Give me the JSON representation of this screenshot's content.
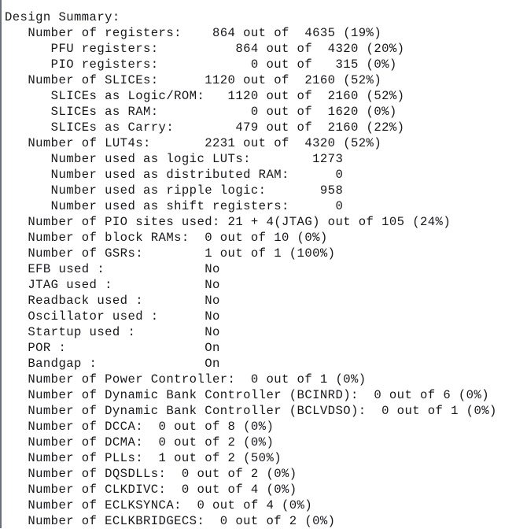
{
  "report": {
    "title": "Design Summary:",
    "text_color": "#15171c",
    "background_color": "#ffffff",
    "left_border_color": "#6b6f7c",
    "lines": [
      "Design Summary:",
      "   Number of registers:    864 out of  4635 (19%)",
      "      PFU registers:          864 out of  4320 (20%)",
      "      PIO registers:            0 out of   315 (0%)",
      "   Number of SLICEs:      1120 out of  2160 (52%)",
      "      SLICEs as Logic/ROM:   1120 out of  2160 (52%)",
      "      SLICEs as RAM:            0 out of  1620 (0%)",
      "      SLICEs as Carry:        479 out of  2160 (22%)",
      "   Number of LUT4s:       2231 out of  4320 (52%)",
      "      Number used as logic LUTs:        1273",
      "      Number used as distributed RAM:      0",
      "      Number used as ripple logic:       958",
      "      Number used as shift registers:      0",
      "   Number of PIO sites used: 21 + 4(JTAG) out of 105 (24%)",
      "   Number of block RAMs:  0 out of 10 (0%)",
      "   Number of GSRs:        1 out of 1 (100%)",
      "   EFB used :             No",
      "   JTAG used :            No",
      "   Readback used :        No",
      "   Oscillator used :      No",
      "   Startup used :         No",
      "   POR :                  On",
      "   Bandgap :              On",
      "   Number of Power Controller:  0 out of 1 (0%)",
      "   Number of Dynamic Bank Controller (BCINRD):  0 out of 6 (0%)",
      "   Number of Dynamic Bank Controller (BCLVDSO):  0 out of 1 (0%)",
      "   Number of DCCA:  0 out of 8 (0%)",
      "   Number of DCMA:  0 out of 2 (0%)",
      "   Number of PLLs:  1 out of 2 (50%)",
      "   Number of DQSDLLs:  0 out of 2 (0%)",
      "   Number of CLKDIVC:  0 out of 4 (0%)",
      "   Number of ECLKSYNCA:  0 out of 4 (0%)",
      "   Number of ECLKBRIDGECS:  0 out of 2 (0%)"
    ],
    "entries": [
      {
        "label": "Number of registers",
        "used": "864",
        "total": "4635",
        "percent": "19%"
      },
      {
        "label": "PFU registers",
        "used": "864",
        "total": "4320",
        "percent": "20%"
      },
      {
        "label": "PIO registers",
        "used": "0",
        "total": "315",
        "percent": "0%"
      },
      {
        "label": "Number of SLICEs",
        "used": "1120",
        "total": "2160",
        "percent": "52%"
      },
      {
        "label": "SLICEs as Logic/ROM",
        "used": "1120",
        "total": "2160",
        "percent": "52%"
      },
      {
        "label": "SLICEs as RAM",
        "used": "0",
        "total": "1620",
        "percent": "0%"
      },
      {
        "label": "SLICEs as Carry",
        "used": "479",
        "total": "2160",
        "percent": "22%"
      },
      {
        "label": "Number of LUT4s",
        "used": "2231",
        "total": "4320",
        "percent": "52%"
      },
      {
        "label": "Number used as logic LUTs",
        "used": "1273",
        "total": "",
        "percent": ""
      },
      {
        "label": "Number used as distributed RAM",
        "used": "0",
        "total": "",
        "percent": ""
      },
      {
        "label": "Number used as ripple logic",
        "used": "958",
        "total": "",
        "percent": ""
      },
      {
        "label": "Number used as shift registers",
        "used": "0",
        "total": "",
        "percent": ""
      },
      {
        "label": "Number of PIO sites used",
        "used": "21 + 4(JTAG)",
        "total": "105",
        "percent": "24%"
      },
      {
        "label": "Number of block RAMs",
        "used": "0",
        "total": "10",
        "percent": "0%"
      },
      {
        "label": "Number of GSRs",
        "used": "1",
        "total": "1",
        "percent": "100%"
      },
      {
        "label": "EFB used",
        "used": "No",
        "total": "",
        "percent": ""
      },
      {
        "label": "JTAG used",
        "used": "No",
        "total": "",
        "percent": ""
      },
      {
        "label": "Readback used",
        "used": "No",
        "total": "",
        "percent": ""
      },
      {
        "label": "Oscillator used",
        "used": "No",
        "total": "",
        "percent": ""
      },
      {
        "label": "Startup used",
        "used": "No",
        "total": "",
        "percent": ""
      },
      {
        "label": "POR",
        "used": "On",
        "total": "",
        "percent": ""
      },
      {
        "label": "Bandgap",
        "used": "On",
        "total": "",
        "percent": ""
      },
      {
        "label": "Number of Power Controller",
        "used": "0",
        "total": "1",
        "percent": "0%"
      },
      {
        "label": "Number of Dynamic Bank Controller (BCINRD)",
        "used": "0",
        "total": "6",
        "percent": "0%"
      },
      {
        "label": "Number of Dynamic Bank Controller (BCLVDSO)",
        "used": "0",
        "total": "1",
        "percent": "0%"
      },
      {
        "label": "Number of DCCA",
        "used": "0",
        "total": "8",
        "percent": "0%"
      },
      {
        "label": "Number of DCMA",
        "used": "0",
        "total": "2",
        "percent": "0%"
      },
      {
        "label": "Number of PLLs",
        "used": "1",
        "total": "2",
        "percent": "50%"
      },
      {
        "label": "Number of DQSDLLs",
        "used": "0",
        "total": "2",
        "percent": "0%"
      },
      {
        "label": "Number of CLKDIVC",
        "used": "0",
        "total": "4",
        "percent": "0%"
      },
      {
        "label": "Number of ECLKSYNCA",
        "used": "0",
        "total": "4",
        "percent": "0%"
      },
      {
        "label": "Number of ECLKBRIDGECS",
        "used": "0",
        "total": "2",
        "percent": "0%"
      }
    ]
  }
}
